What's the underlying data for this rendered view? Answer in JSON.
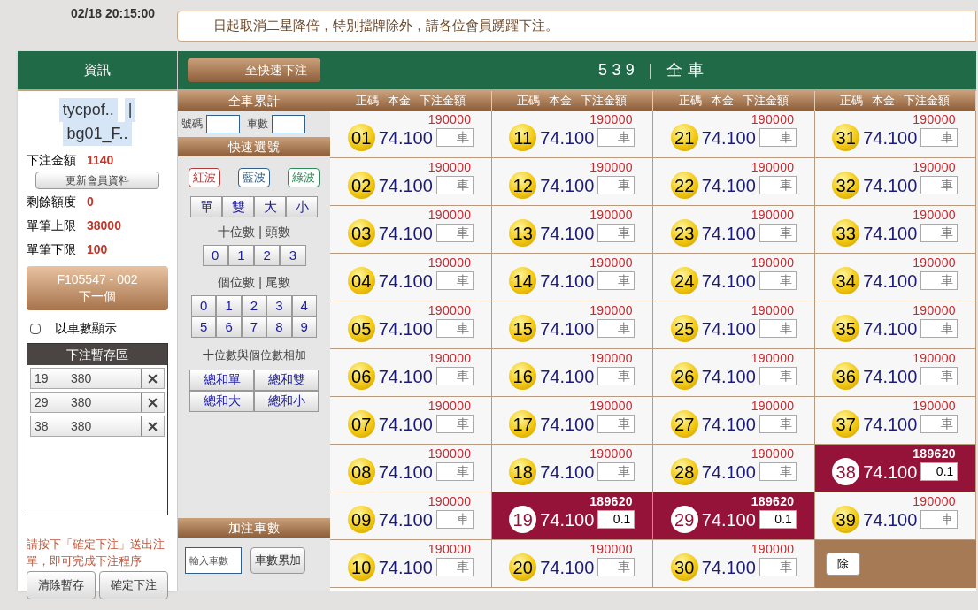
{
  "timestamp": "02/18 20:15:00",
  "marquee": "日起取消二星降倍，特別擋牌除外，請各位會員踴躍下注。",
  "left_panel": {
    "title": "資訊",
    "users": [
      "tycpof..",
      "|",
      "bg01_F.."
    ],
    "bet_total": {
      "label": "下注金額",
      "value": "1140"
    },
    "refresh_button": "更新會員資料",
    "stats": [
      {
        "label": "剩餘額度",
        "value": "0"
      },
      {
        "label": "單筆上限",
        "value": "38000"
      },
      {
        "label": "單筆下限",
        "value": "100"
      }
    ],
    "next_button": {
      "code": "F105547 - 002",
      "label": "下一個"
    },
    "show_by_count": {
      "label": "以車數顯示",
      "checked": false
    },
    "cart": {
      "title": "下注暫存區",
      "items": [
        {
          "number": "19",
          "amount": "380"
        },
        {
          "number": "29",
          "amount": "380"
        },
        {
          "number": "38",
          "amount": "380"
        }
      ]
    },
    "note": "請按下「確定下注」送出注單，即可完成下注程序",
    "buttons": [
      "清除暫存",
      "確定下注"
    ]
  },
  "middle_panel": {
    "quick_button": "至快速下注",
    "total_title": "全車累計",
    "number_label": "號碼",
    "count_label": "車數",
    "quick_title": "快速選號",
    "waves": [
      {
        "label": "紅波",
        "color": "#b03a3a"
      },
      {
        "label": "藍波",
        "color": "#2f5f8a"
      },
      {
        "label": "綠波",
        "color": "#2e8b57"
      }
    ],
    "parity": [
      "單",
      "雙",
      "大",
      "小"
    ],
    "tens_label": "十位數 | 頭數",
    "tens": [
      "0",
      "1",
      "2",
      "3"
    ],
    "units_label": "個位數 | 尾數",
    "units": [
      "0",
      "1",
      "2",
      "3",
      "4",
      "5",
      "6",
      "7",
      "8",
      "9"
    ],
    "sum_label": "十位數與個位數相加",
    "sums": [
      "總和單",
      "總和雙",
      "總和大",
      "總和小"
    ],
    "add_title": "加注車數",
    "add_placeholder": "輸入車數",
    "add_button": "車數累加"
  },
  "table": {
    "title": "539 | 全車",
    "column_groups": [
      [
        "正碼",
        "本金",
        "下注金額"
      ],
      [
        "正碼",
        "本金",
        "下注金額"
      ],
      [
        "正碼",
        "本金",
        "下注金額"
      ],
      [
        "正碼",
        "本金",
        "下注金額"
      ]
    ],
    "cells": [
      {
        "number": "01",
        "odds": "74.100",
        "limit": "190000",
        "selected": false,
        "placeholder": "車"
      },
      {
        "number": "02",
        "odds": "74.100",
        "limit": "190000",
        "selected": false,
        "placeholder": "車"
      },
      {
        "number": "03",
        "odds": "74.100",
        "limit": "190000",
        "selected": false,
        "placeholder": "車"
      },
      {
        "number": "04",
        "odds": "74.100",
        "limit": "190000",
        "selected": false,
        "placeholder": "車"
      },
      {
        "number": "05",
        "odds": "74.100",
        "limit": "190000",
        "selected": false,
        "placeholder": "車"
      },
      {
        "number": "06",
        "odds": "74.100",
        "limit": "190000",
        "selected": false,
        "placeholder": "車"
      },
      {
        "number": "07",
        "odds": "74.100",
        "limit": "190000",
        "selected": false,
        "placeholder": "車"
      },
      {
        "number": "08",
        "odds": "74.100",
        "limit": "190000",
        "selected": false,
        "placeholder": "車"
      },
      {
        "number": "09",
        "odds": "74.100",
        "limit": "190000",
        "selected": false,
        "placeholder": "車"
      },
      {
        "number": "10",
        "odds": "74.100",
        "limit": "190000",
        "selected": false,
        "placeholder": "車"
      },
      {
        "number": "11",
        "odds": "74.100",
        "limit": "190000",
        "selected": false,
        "placeholder": "車"
      },
      {
        "number": "12",
        "odds": "74.100",
        "limit": "190000",
        "selected": false,
        "placeholder": "車"
      },
      {
        "number": "13",
        "odds": "74.100",
        "limit": "190000",
        "selected": false,
        "placeholder": "車"
      },
      {
        "number": "14",
        "odds": "74.100",
        "limit": "190000",
        "selected": false,
        "placeholder": "車"
      },
      {
        "number": "15",
        "odds": "74.100",
        "limit": "190000",
        "selected": false,
        "placeholder": "車"
      },
      {
        "number": "16",
        "odds": "74.100",
        "limit": "190000",
        "selected": false,
        "placeholder": "車"
      },
      {
        "number": "17",
        "odds": "74.100",
        "limit": "190000",
        "selected": false,
        "placeholder": "車"
      },
      {
        "number": "18",
        "odds": "74.100",
        "limit": "190000",
        "selected": false,
        "placeholder": "車"
      },
      {
        "number": "19",
        "odds": "74.100",
        "limit": "189620",
        "selected": true,
        "value": "0.1"
      },
      {
        "number": "20",
        "odds": "74.100",
        "limit": "190000",
        "selected": false,
        "placeholder": "車"
      },
      {
        "number": "21",
        "odds": "74.100",
        "limit": "190000",
        "selected": false,
        "placeholder": "車"
      },
      {
        "number": "22",
        "odds": "74.100",
        "limit": "190000",
        "selected": false,
        "placeholder": "車"
      },
      {
        "number": "23",
        "odds": "74.100",
        "limit": "190000",
        "selected": false,
        "placeholder": "車"
      },
      {
        "number": "24",
        "odds": "74.100",
        "limit": "190000",
        "selected": false,
        "placeholder": "車"
      },
      {
        "number": "25",
        "odds": "74.100",
        "limit": "190000",
        "selected": false,
        "placeholder": "車"
      },
      {
        "number": "26",
        "odds": "74.100",
        "limit": "190000",
        "selected": false,
        "placeholder": "車"
      },
      {
        "number": "27",
        "odds": "74.100",
        "limit": "190000",
        "selected": false,
        "placeholder": "車"
      },
      {
        "number": "28",
        "odds": "74.100",
        "limit": "190000",
        "selected": false,
        "placeholder": "車"
      },
      {
        "number": "29",
        "odds": "74.100",
        "limit": "189620",
        "selected": true,
        "value": "0.1"
      },
      {
        "number": "30",
        "odds": "74.100",
        "limit": "190000",
        "selected": false,
        "placeholder": "車"
      },
      {
        "number": "31",
        "odds": "74.100",
        "limit": "190000",
        "selected": false,
        "placeholder": "車"
      },
      {
        "number": "32",
        "odds": "74.100",
        "limit": "190000",
        "selected": false,
        "placeholder": "車"
      },
      {
        "number": "33",
        "odds": "74.100",
        "limit": "190000",
        "selected": false,
        "placeholder": "車"
      },
      {
        "number": "34",
        "odds": "74.100",
        "limit": "190000",
        "selected": false,
        "placeholder": "車"
      },
      {
        "number": "35",
        "odds": "74.100",
        "limit": "190000",
        "selected": false,
        "placeholder": "車"
      },
      {
        "number": "36",
        "odds": "74.100",
        "limit": "190000",
        "selected": false,
        "placeholder": "車"
      },
      {
        "number": "37",
        "odds": "74.100",
        "limit": "190000",
        "selected": false,
        "placeholder": "車"
      },
      {
        "number": "38",
        "odds": "74.100",
        "limit": "189620",
        "selected": true,
        "value": "0.1"
      },
      {
        "number": "39",
        "odds": "74.100",
        "limit": "190000",
        "selected": false,
        "placeholder": "車"
      }
    ],
    "corner_button": "除"
  }
}
